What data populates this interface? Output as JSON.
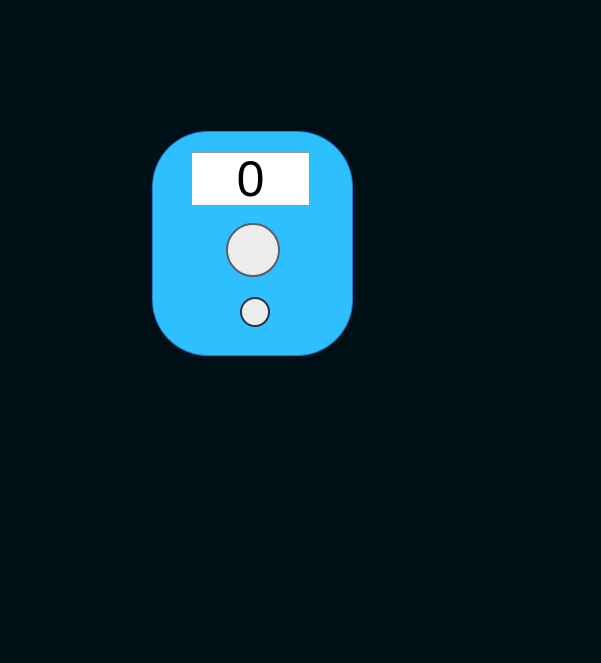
{
  "counter": {
    "display_value": "0"
  },
  "colors": {
    "background": "#001017",
    "counter_body": "#2ebfff",
    "display_bg": "#ffffff",
    "button_face": "#ececec"
  }
}
